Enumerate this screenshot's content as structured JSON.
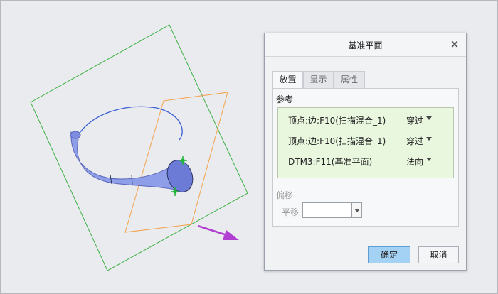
{
  "dialog": {
    "title": "基准平面",
    "close_glyph": "×",
    "tabs": [
      {
        "label": "放置",
        "active": true
      },
      {
        "label": "显示",
        "active": false
      },
      {
        "label": "属性",
        "active": false
      }
    ],
    "references_label": "参考",
    "references": [
      {
        "name": "顶点:边:F10(扫描混合_1)",
        "constraint": "穿过"
      },
      {
        "name": "顶点:边:F10(扫描混合_1)",
        "constraint": "穿过"
      },
      {
        "name": "DTM3:F11(基准平面)",
        "constraint": "法向"
      }
    ],
    "offset_label": "偏移",
    "translate_label": "平移",
    "offset_value": "",
    "ok_label": "确定",
    "cancel_label": "取消"
  },
  "colors": {
    "datum_plane_green": "#3cb043",
    "datum_plane_orange": "#f5a04a",
    "sweep_curve": "#3b5fd6",
    "solid_body": "#8f9ee8",
    "direction_arrow": "#b13fd2",
    "vertex_marker": "#1fb83a",
    "reference_highlight": "#e9f7df",
    "ok_button": "#a4d2f5"
  }
}
